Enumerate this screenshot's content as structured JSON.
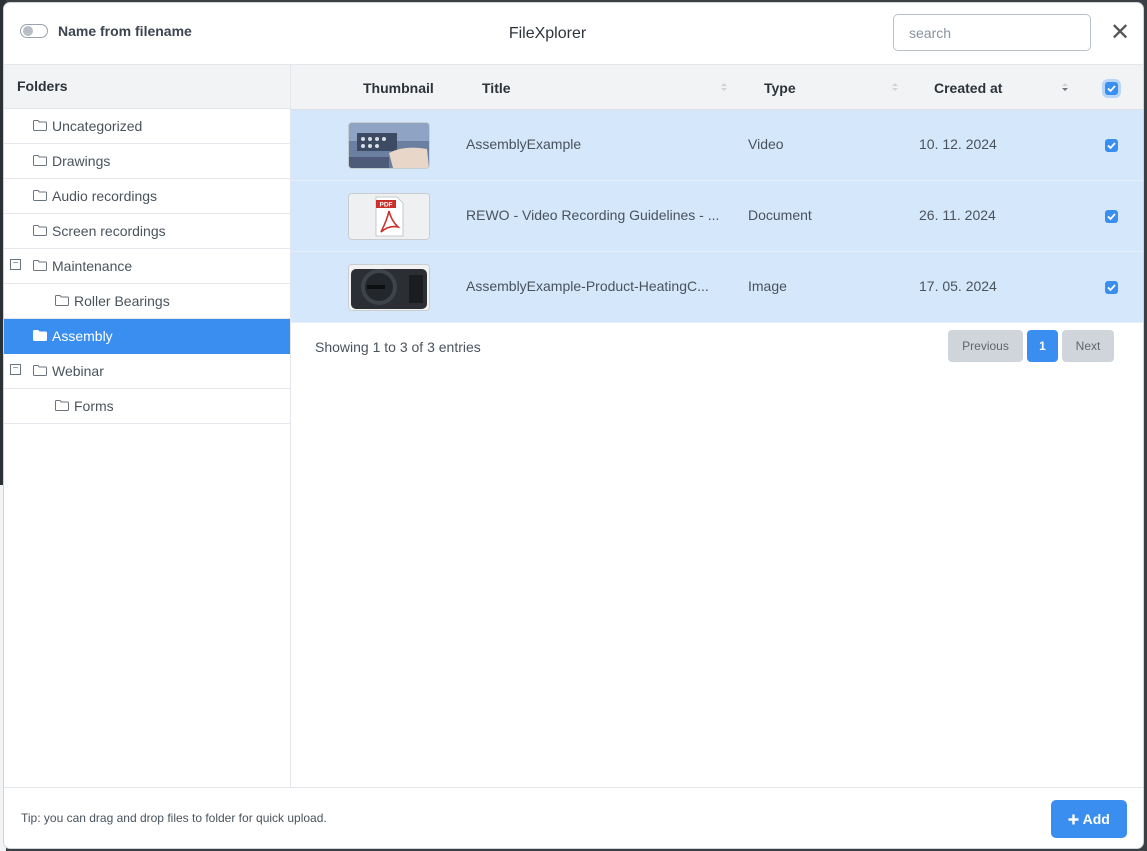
{
  "header": {
    "toggle_label": "Name from filename",
    "title": "FileXplorer",
    "search_placeholder": "search",
    "close_glyph": "✕"
  },
  "sidebar": {
    "heading": "Folders",
    "folders": [
      {
        "label": "Uncategorized",
        "level": 0,
        "expandable": false,
        "active": false
      },
      {
        "label": "Drawings",
        "level": 0,
        "expandable": false,
        "active": false
      },
      {
        "label": "Audio recordings",
        "level": 0,
        "expandable": false,
        "active": false
      },
      {
        "label": "Screen recordings",
        "level": 0,
        "expandable": false,
        "active": false
      },
      {
        "label": "Maintenance",
        "level": 0,
        "expandable": true,
        "expand_glyph": "−",
        "active": false
      },
      {
        "label": "Roller Bearings",
        "level": 1,
        "expandable": false,
        "active": false
      },
      {
        "label": "Assembly",
        "level": 0,
        "expandable": false,
        "active": true
      },
      {
        "label": "Webinar",
        "level": 0,
        "expandable": true,
        "expand_glyph": "−",
        "active": false
      },
      {
        "label": "Forms",
        "level": 1,
        "expandable": false,
        "active": false
      }
    ]
  },
  "table": {
    "headers": {
      "thumbnail": "Thumbnail",
      "title": "Title",
      "type": "Type",
      "created": "Created at"
    },
    "rows": [
      {
        "title": "AssemblyExample",
        "type": "Video",
        "created": "10. 12. 2024",
        "thumb": "video-thumbnail",
        "checked": true
      },
      {
        "title": "REWO - Video Recording Guidelines - ...",
        "type": "Document",
        "created": "26. 11. 2024",
        "thumb": "pdf-icon",
        "checked": true
      },
      {
        "title": "AssemblyExample-Product-HeatingC...",
        "type": "Image",
        "created": "17. 05. 2024",
        "thumb": "image-thumbnail",
        "checked": true
      }
    ],
    "info": "Showing 1 to 3 of 3 entries",
    "pagination": {
      "previous": "Previous",
      "page": "1",
      "next": "Next"
    }
  },
  "footer": {
    "tip": "Tip: you can drag and drop files to folder for quick upload.",
    "add_label": "Add"
  },
  "colors": {
    "accent": "#3a8ef0",
    "selected_row": "#d5e7fb"
  }
}
